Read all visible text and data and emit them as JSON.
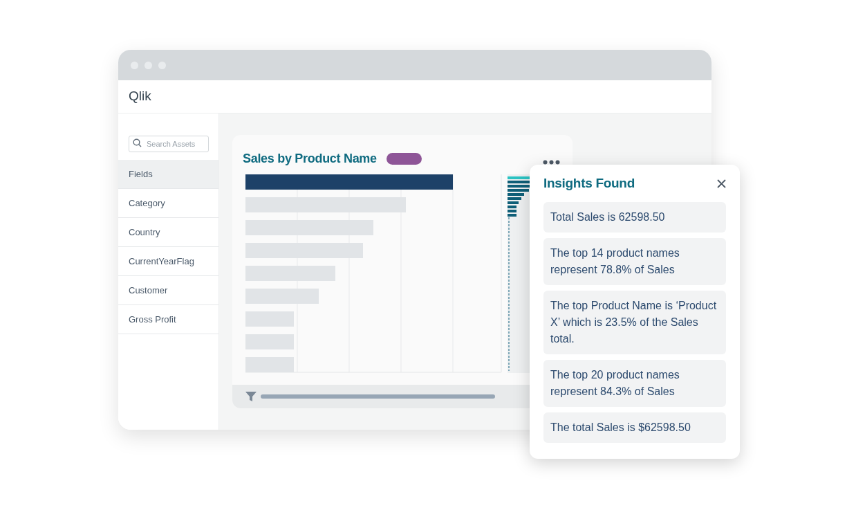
{
  "header": {
    "logo": "Qlik"
  },
  "sidebar": {
    "search": {
      "placeholder": "Search Assets"
    },
    "items": [
      {
        "label": "Fields",
        "selected": true
      },
      {
        "label": "Category",
        "selected": false
      },
      {
        "label": "Country",
        "selected": false
      },
      {
        "label": "CurrentYearFlag",
        "selected": false
      },
      {
        "label": "Customer",
        "selected": false
      },
      {
        "label": "Gross Profit",
        "selected": false
      }
    ]
  },
  "chart": {
    "title": "Sales by Product Name"
  },
  "insights": {
    "title": "Insights Found",
    "items": [
      "Total Sales is 62598.50",
      "The top 14 product names represent 78.8% of Sales",
      "The top Product Name is ‘Product X’ which is 23.5% of the Sales total.",
      "The top 20 product names represent 84.3% of Sales",
      "The total Sales is $62598.50"
    ]
  }
}
